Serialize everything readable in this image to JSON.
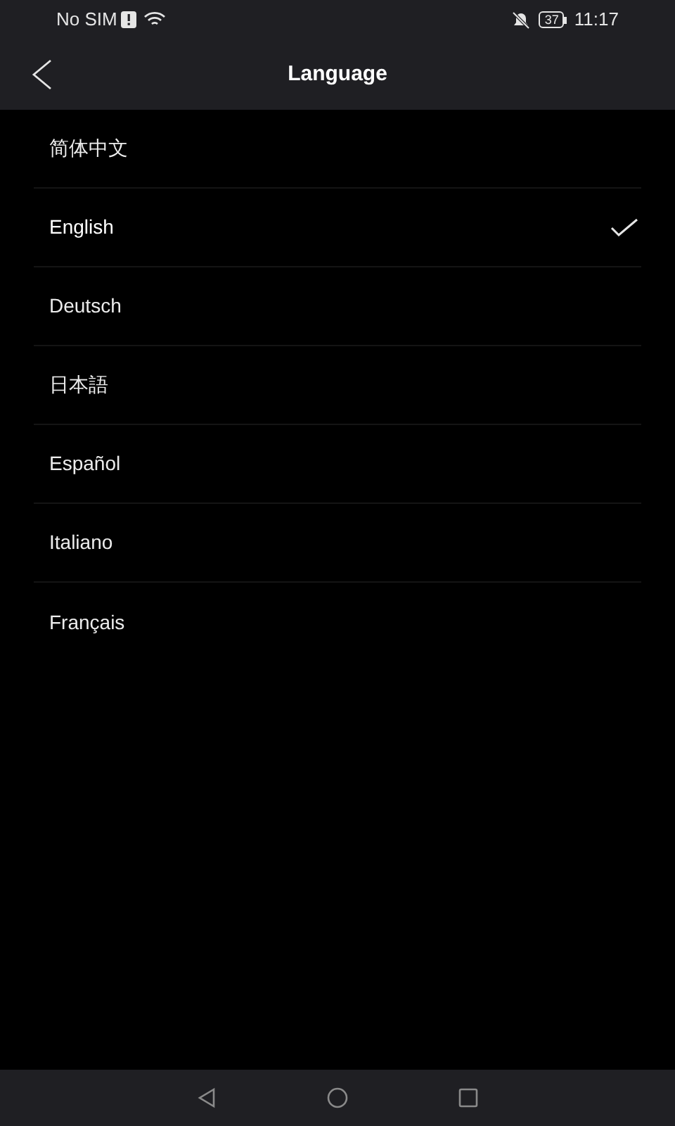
{
  "status_bar": {
    "carrier": "No SIM",
    "battery": "37",
    "time": "11:17"
  },
  "header": {
    "title": "Language"
  },
  "languages": [
    {
      "label": "简体中文",
      "selected": false
    },
    {
      "label": "English",
      "selected": true
    },
    {
      "label": "Deutsch",
      "selected": false
    },
    {
      "label": "日本語",
      "selected": false
    },
    {
      "label": "Español",
      "selected": false
    },
    {
      "label": "Italiano",
      "selected": false
    },
    {
      "label": "Français",
      "selected": false
    }
  ]
}
